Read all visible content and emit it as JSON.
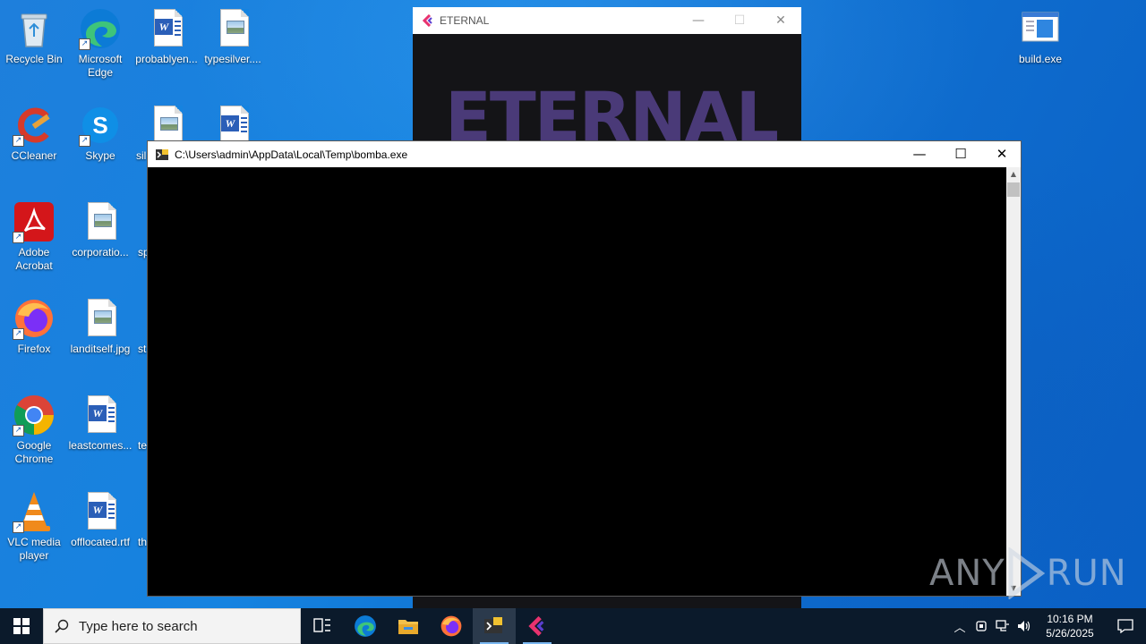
{
  "desktop": {
    "icons": [
      {
        "label": "Recycle Bin"
      },
      {
        "label": "Microsoft Edge"
      },
      {
        "label": "probablyen..."
      },
      {
        "label": "typesilver...."
      },
      {
        "label": "CCleaner"
      },
      {
        "label": "Skype"
      },
      {
        "label": "sil"
      },
      {
        "label": "Adobe Acrobat"
      },
      {
        "label": "corporatio..."
      },
      {
        "label": "sp"
      },
      {
        "label": "Firefox"
      },
      {
        "label": "landitself.jpg"
      },
      {
        "label": "st"
      },
      {
        "label": "Google Chrome"
      },
      {
        "label": "leastcomes..."
      },
      {
        "label": "te"
      },
      {
        "label": "VLC media player"
      },
      {
        "label": "offlocated.rtf"
      },
      {
        "label": "th"
      },
      {
        "label": "build.exe"
      }
    ]
  },
  "eternal_window": {
    "title": "ETERNAL",
    "banner": "ETERNAL"
  },
  "console_window": {
    "title": "C:\\Users\\admin\\AppData\\Local\\Temp\\bomba.exe"
  },
  "watermark": {
    "text_left": "ANY",
    "text_right": "RUN"
  },
  "taskbar": {
    "search_placeholder": "Type here to search",
    "clock_time": "10:16 PM",
    "clock_date": "5/26/2025"
  },
  "colors": {
    "desktop_bg": "#1583e0",
    "taskbar_bg": "#0b1a2b",
    "eternal_banner": "#4a3a78"
  }
}
